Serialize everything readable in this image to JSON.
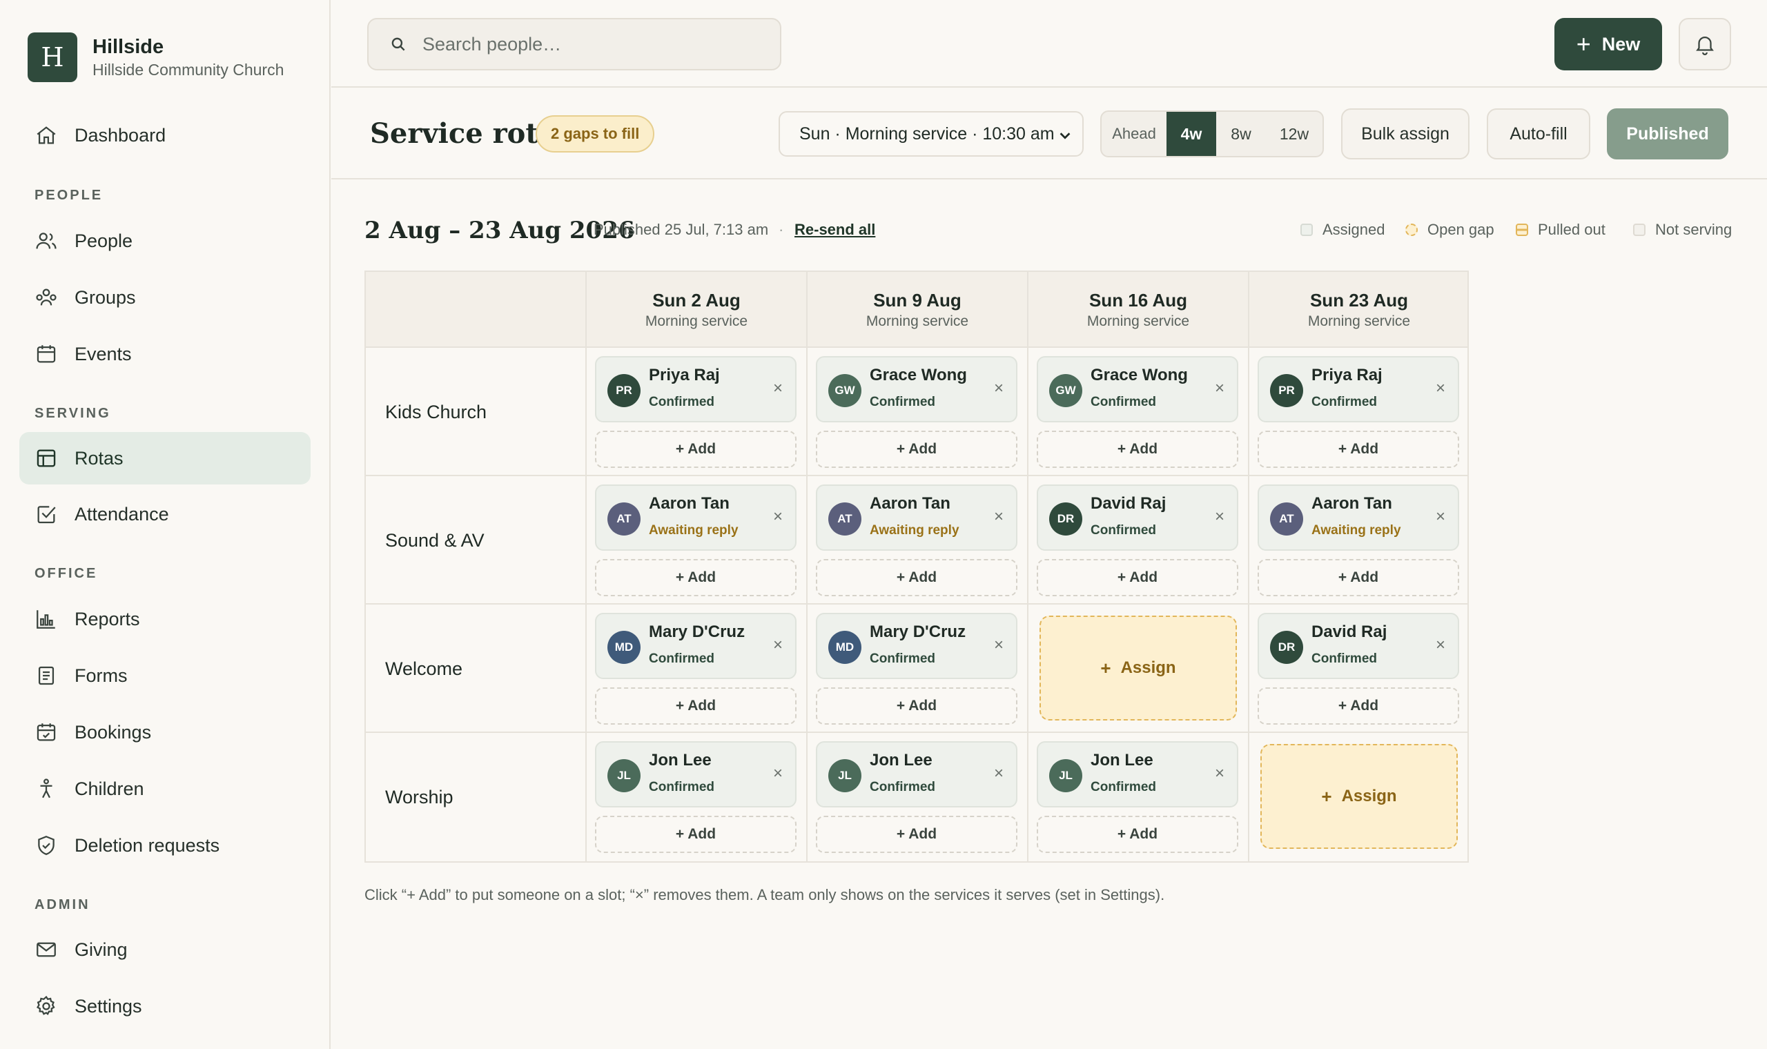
{
  "brand": {
    "initial": "H",
    "name": "Hillside",
    "org": "Hillside Community Church"
  },
  "sidebar": {
    "dashboard": "Dashboard",
    "sections": {
      "people": "PEOPLE",
      "serving": "SERVING",
      "office": "OFFICE",
      "admin": "ADMIN"
    },
    "items": {
      "people": "People",
      "groups": "Groups",
      "events": "Events",
      "rotas": "Rotas",
      "attendance": "Attendance",
      "reports": "Reports",
      "forms": "Forms",
      "bookings": "Bookings",
      "children": "Children",
      "deletion": "Deletion requests",
      "giving": "Giving",
      "settings": "Settings"
    }
  },
  "topbar": {
    "search_placeholder": "Search people…",
    "new_label": "New"
  },
  "toolbar": {
    "title": "Service rota",
    "gap_badge": "2 gaps to fill",
    "service": "Sun · Morning service · 10:30 am",
    "ahead_label": "Ahead",
    "weeks": [
      "4w",
      "8w",
      "12w"
    ],
    "active_week": "4w",
    "bulk": "Bulk assign",
    "autofill": "Auto-fill",
    "published": "Published"
  },
  "summary": {
    "range": "2 Aug – 23 Aug 2026",
    "published_meta": "Published 25 Jul, 7:13 am",
    "separator": "·",
    "resend": "Re-send all"
  },
  "legend": {
    "assigned": "Assigned",
    "open_gap": "Open gap",
    "pulled_out": "Pulled out",
    "not_serving": "Not serving"
  },
  "colors": {
    "primary": "#2f4a3c",
    "gap_bg": "#fdf0d0",
    "gap_border": "#e2b65a",
    "confirmed": "#2f4a3c",
    "awaiting": "#9a7218"
  },
  "grid": {
    "columns": [
      {
        "date": "Sun 2 Aug",
        "service": "Morning service"
      },
      {
        "date": "Sun 9 Aug",
        "service": "Morning service"
      },
      {
        "date": "Sun 16 Aug",
        "service": "Morning service"
      },
      {
        "date": "Sun 23 Aug",
        "service": "Morning service"
      }
    ],
    "add_label": "+ Add",
    "assign_label": "Assign",
    "remove_glyph": "×",
    "rows": [
      {
        "team": "Kids Church",
        "cells": [
          {
            "initials": "PR",
            "name": "Priya Raj",
            "status": "Confirmed"
          },
          {
            "initials": "GW",
            "name": "Grace Wong",
            "status": "Confirmed"
          },
          {
            "initials": "GW",
            "name": "Grace Wong",
            "status": "Confirmed"
          },
          {
            "initials": "PR",
            "name": "Priya Raj",
            "status": "Confirmed"
          }
        ]
      },
      {
        "team": "Sound & AV",
        "cells": [
          {
            "initials": "AT",
            "name": "Aaron Tan",
            "status": "Awaiting reply"
          },
          {
            "initials": "AT",
            "name": "Aaron Tan",
            "status": "Awaiting reply"
          },
          {
            "initials": "DR",
            "name": "David Raj",
            "status": "Confirmed"
          },
          {
            "initials": "AT",
            "name": "Aaron Tan",
            "status": "Awaiting reply"
          }
        ]
      },
      {
        "team": "Welcome",
        "cells": [
          {
            "initials": "MD",
            "name": "Mary D'Cruz",
            "status": "Confirmed"
          },
          {
            "initials": "MD",
            "name": "Mary D'Cruz",
            "status": "Confirmed"
          },
          {
            "gap": true
          },
          {
            "initials": "DR",
            "name": "David Raj",
            "status": "Confirmed"
          }
        ]
      },
      {
        "team": "Worship",
        "cells": [
          {
            "initials": "JL",
            "name": "Jon Lee",
            "status": "Confirmed"
          },
          {
            "initials": "JL",
            "name": "Jon Lee",
            "status": "Confirmed"
          },
          {
            "initials": "JL",
            "name": "Jon Lee",
            "status": "Confirmed"
          },
          {
            "gap": true
          }
        ]
      }
    ]
  },
  "footnote": "Click “+ Add” to put someone on a slot; “×” removes them. A team only shows on the services it serves (set in Settings)."
}
